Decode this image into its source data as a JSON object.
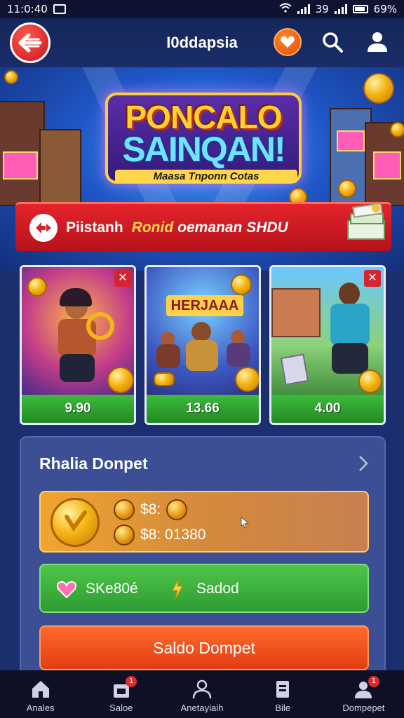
{
  "status_bar": {
    "time": "11:0:40",
    "signal_text": "39",
    "battery": "69%"
  },
  "header": {
    "title": "I0ddapsia"
  },
  "hero": {
    "title_line1": "PONCALO",
    "title_line2": "SAINQAN!",
    "subtitle": "Maasa Tnponn Cotas"
  },
  "ribbon": {
    "label": "Piistanh",
    "highlight": "Ronid",
    "rest": "oemanan SHDU"
  },
  "games": [
    {
      "price": "9.90",
      "theme": "warrior"
    },
    {
      "price": "13.66",
      "banner": "HERJAAA",
      "theme": "crew"
    },
    {
      "price": "4.00",
      "theme": "brawler"
    }
  ],
  "wallet": {
    "title": "Rhalia Donpet",
    "balance_line1": "$8:",
    "balance_line2": "$8: 01380",
    "green_label1": "SKe80é",
    "green_label2": "Sadod",
    "action_label": "Saldo Dompet"
  },
  "nav": [
    {
      "label": "Anales",
      "icon": "home-icon",
      "badge": ""
    },
    {
      "label": "Saloe",
      "icon": "shop-icon",
      "badge": "1"
    },
    {
      "label": "Anetayiaih",
      "icon": "user-group-icon",
      "badge": ""
    },
    {
      "label": "Bile",
      "icon": "document-icon",
      "badge": ""
    },
    {
      "label": "Dompepet",
      "icon": "account-icon",
      "badge": "1"
    }
  ],
  "colors": {
    "primary": "#1b2f6e",
    "accent_red": "#d62330",
    "accent_green": "#2e9b32",
    "accent_orange": "#e23d14",
    "gold": "#f4b413"
  }
}
